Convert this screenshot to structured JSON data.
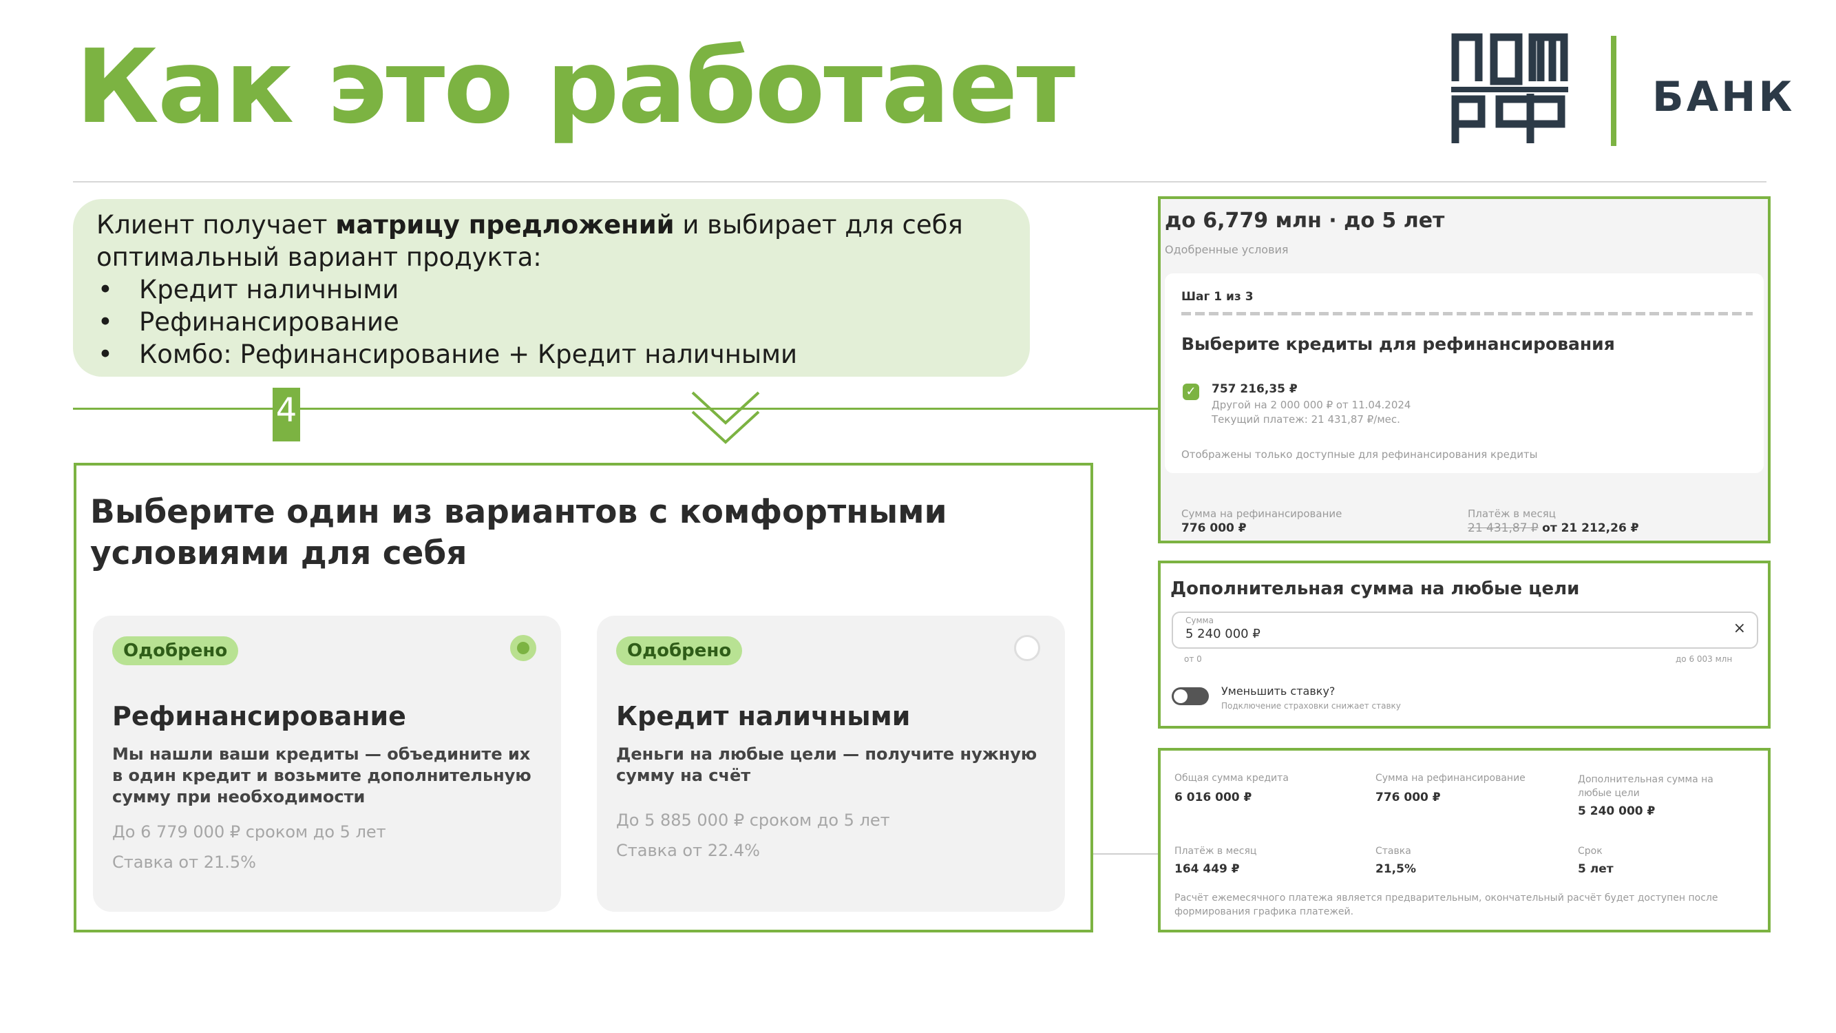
{
  "title": "Как это работает",
  "logo": {
    "top": "ДОМ",
    "bottom": "РФ",
    "bank": "БАНК"
  },
  "intro": {
    "line_prefix": "Клиент получает ",
    "line_bold": "матрицу предложений",
    "line_suffix": " и выбирает для себя оптимальный вариант продукта:",
    "items": [
      "Кредит наличными",
      "Рефинансирование",
      "Комбо: Рефинансирование + Кредит наличными"
    ]
  },
  "step_number": "4",
  "main": {
    "heading": "Выберите один из вариантов с комфортными условиями для себя",
    "cards": [
      {
        "badge": "Одобрено",
        "title": "Рефинансирование",
        "desc": "Мы нашли ваши кредиты — объедините их в один кредит и возьмите дополнительную сумму при необходимости",
        "limit": "До 6 779 000 ₽ сроком до 5 лет",
        "rate": "Ставка от 21.5%"
      },
      {
        "badge": "Одобрено",
        "title": "Кредит наличными",
        "desc": "Деньги на любые цели — получите нужную сумму на счёт",
        "limit": "До 5 885 000 ₽ сроком до 5 лет",
        "rate": "Ставка от 22.4%"
      }
    ]
  },
  "refi": {
    "header": "до 6,779 млн · до 5 лет",
    "subheader": "Одобренные условия",
    "step": "Шаг 1 из 3",
    "heading": "Выберите кредиты для рефинансирования",
    "loan_amount": "757 216,35 ₽",
    "loan_other": "Другой на 2 000 000 ₽ от 11.04.2024",
    "loan_payment": "Текущий платеж: 21 431,87 ₽/мес.",
    "note": "Отображены только доступные для рефинансирования кредиты",
    "sum_label": "Сумма на рефинансирование",
    "sum_value": "776 000 ₽",
    "pay_label": "Платёж в месяц",
    "pay_old": "21 431,87 ₽",
    "pay_new": "от 21 212,26 ₽"
  },
  "extra": {
    "heading": "Дополнительная сумма на любые цели",
    "field_label": "Сумма",
    "field_value": "5 240 000 ₽",
    "clear": "×",
    "min_hint": "от 0",
    "max_hint": "до 6 003 млн",
    "toggle_label": "Уменьшить ставку?",
    "toggle_hint": "Подключение страховки снижает ставку"
  },
  "summary": {
    "cells": [
      {
        "label": "Общая сумма кредита",
        "value": "6 016 000 ₽"
      },
      {
        "label": "Сумма на рефинансирование",
        "value": "776 000 ₽"
      },
      {
        "label": "Дополнительная сумма на любые цели",
        "value": "5 240 000 ₽"
      },
      {
        "label": "Платёж в месяц",
        "value": "164 449 ₽"
      },
      {
        "label": "Ставка",
        "value": "21,5%"
      },
      {
        "label": "Срок",
        "value": "5 лет"
      }
    ],
    "disclaimer": "Расчёт ежемесячного платежа является предварительным, окончательный расчёт будет доступен после формирования графика платежей."
  }
}
